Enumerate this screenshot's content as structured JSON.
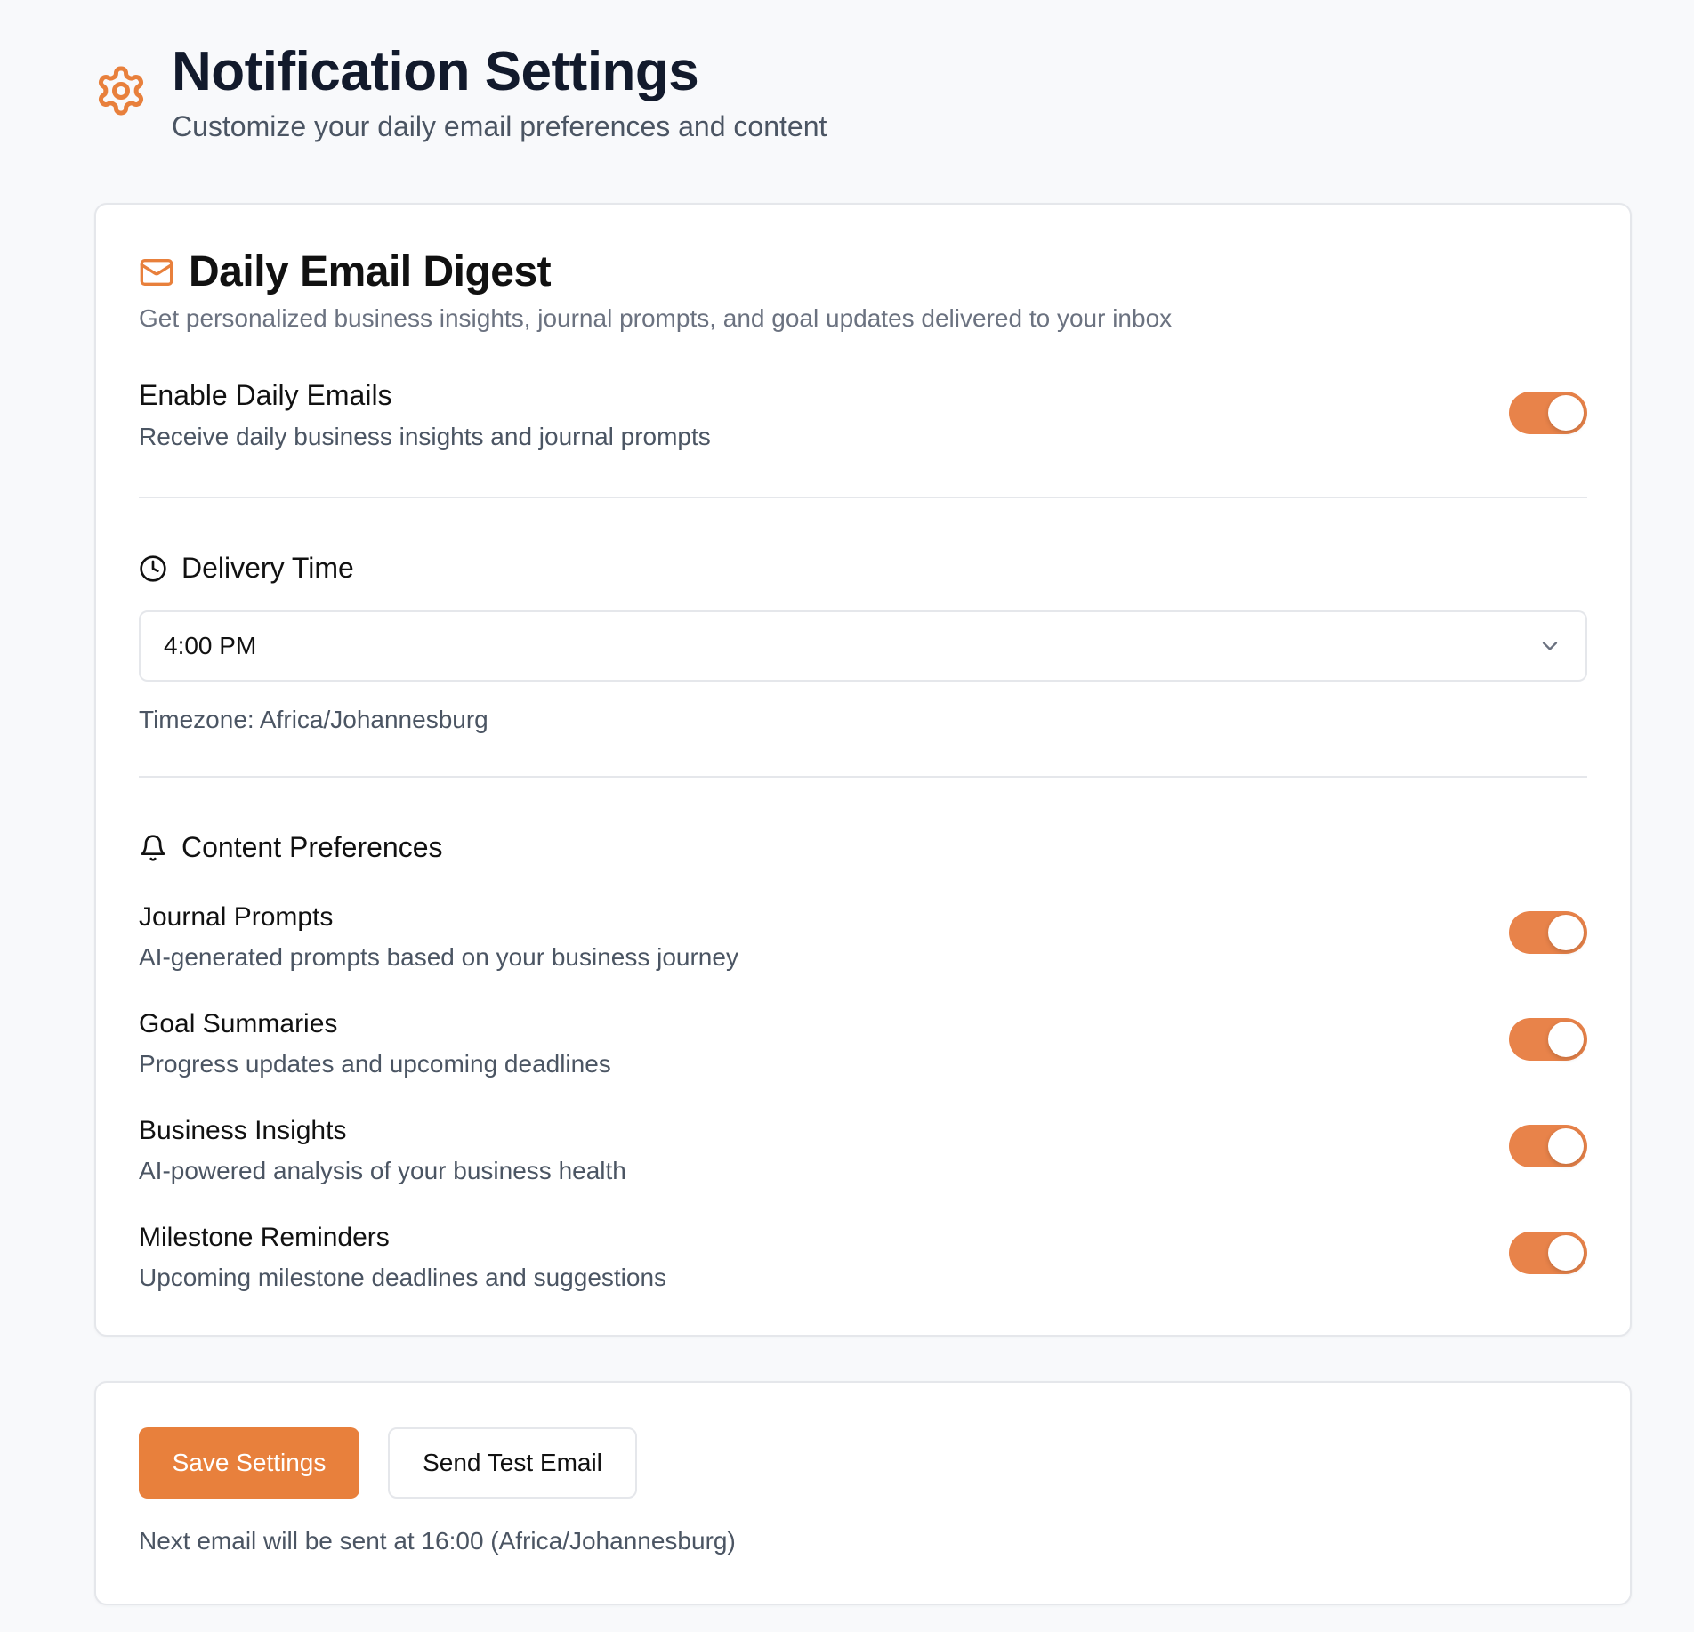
{
  "header": {
    "title": "Notification Settings",
    "subtitle": "Customize your daily email preferences and content",
    "icon": "gear-icon"
  },
  "digest": {
    "title": "Daily Email Digest",
    "description": "Get personalized business insights, journal prompts, and goal updates delivered to your inbox",
    "icon": "mail-icon"
  },
  "enable": {
    "label": "Enable Daily Emails",
    "description": "Receive daily business insights and journal prompts",
    "enabled": true
  },
  "delivery": {
    "heading": "Delivery Time",
    "icon": "clock-icon",
    "selected_time": "4:00 PM",
    "timezone_text": "Timezone: Africa/Johannesburg"
  },
  "content": {
    "heading": "Content Preferences",
    "icon": "bell-icon",
    "items": [
      {
        "label": "Journal Prompts",
        "description": "AI-generated prompts based on your business journey",
        "enabled": true
      },
      {
        "label": "Goal Summaries",
        "description": "Progress updates and upcoming deadlines",
        "enabled": true
      },
      {
        "label": "Business Insights",
        "description": "AI-powered analysis of your business health",
        "enabled": true
      },
      {
        "label": "Milestone Reminders",
        "description": "Upcoming milestone deadlines and suggestions",
        "enabled": true
      }
    ]
  },
  "actions": {
    "save_label": "Save Settings",
    "test_label": "Send Test Email",
    "next_email_text": "Next email will be sent at 16:00 (Africa/Johannesburg)"
  },
  "colors": {
    "accent": "#e8803c",
    "toggle_on": "#e8834a",
    "background": "#f8f9fb"
  }
}
